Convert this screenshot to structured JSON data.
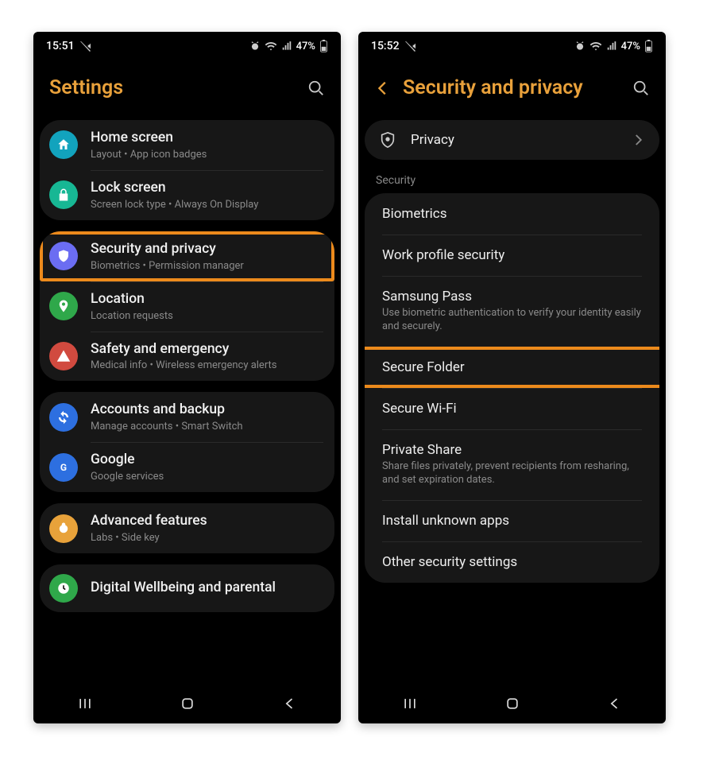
{
  "left": {
    "status": {
      "time": "15:51",
      "battery": "47%"
    },
    "header": {
      "title": "Settings"
    },
    "groups": [
      [
        {
          "title": "Home screen",
          "sub": "Layout  •  App icon badges",
          "icon": "home",
          "color": "#12a3bd"
        },
        {
          "title": "Lock screen",
          "sub": "Screen lock type  •  Always On Display",
          "icon": "lock",
          "color": "#17b794"
        }
      ],
      [
        {
          "title": "Security and privacy",
          "sub": "Biometrics  •  Permission manager",
          "icon": "shield",
          "color": "#6b6df2",
          "highlight": true
        },
        {
          "title": "Location",
          "sub": "Location requests",
          "icon": "pin",
          "color": "#2fa84a"
        },
        {
          "title": "Safety and emergency",
          "sub": "Medical info  •  Wireless emergency alerts",
          "icon": "alert",
          "color": "#d14a3f"
        }
      ],
      [
        {
          "title": "Accounts and backup",
          "sub": "Manage accounts  •  Smart Switch",
          "icon": "sync",
          "color": "#2d6fe0"
        },
        {
          "title": "Google",
          "sub": "Google services",
          "icon": "google",
          "color": "#2d6fe0"
        }
      ],
      [
        {
          "title": "Advanced features",
          "sub": "Labs  •  Side key",
          "icon": "advanced",
          "color": "#e8a23a"
        }
      ],
      [
        {
          "title": "Digital Wellbeing and parental",
          "sub": "",
          "icon": "wellbeing",
          "color": "#2fa84a"
        }
      ]
    ]
  },
  "right": {
    "status": {
      "time": "15:52",
      "battery": "47%"
    },
    "header": {
      "title": "Security and privacy"
    },
    "privacy": {
      "label": "Privacy"
    },
    "section_label": "Security",
    "items": [
      {
        "title": "Biometrics"
      },
      {
        "title": "Work profile security"
      },
      {
        "title": "Samsung Pass",
        "sub": "Use biometric authentication to verify your identity easily and securely."
      },
      {
        "title": "Secure Folder",
        "highlight": true
      },
      {
        "title": "Secure Wi-Fi"
      },
      {
        "title": "Private Share",
        "sub": "Share files privately, prevent recipients from resharing, and set expiration dates."
      },
      {
        "title": "Install unknown apps"
      },
      {
        "title": "Other security settings"
      }
    ]
  }
}
